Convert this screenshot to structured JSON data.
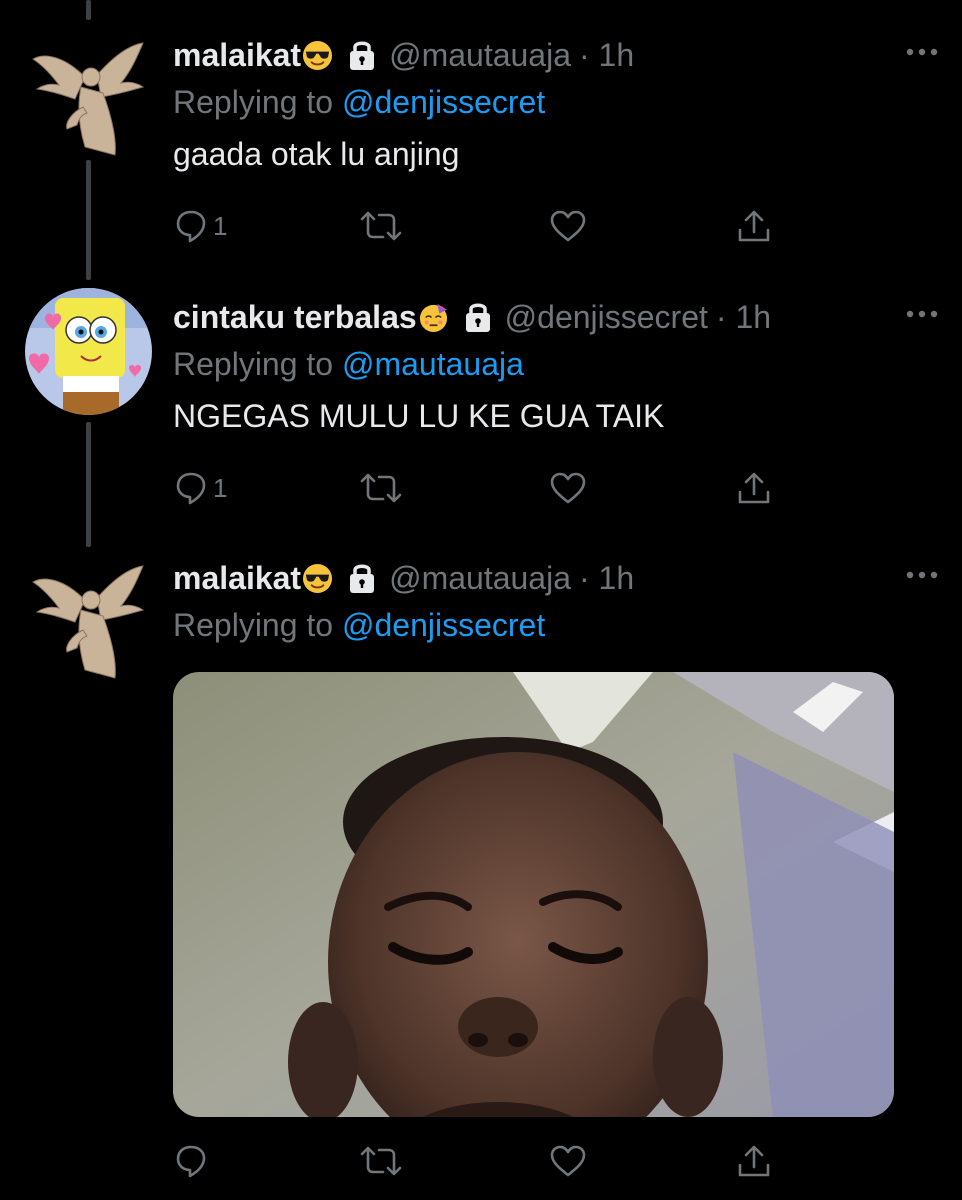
{
  "tweets": [
    {
      "display_name": "malaikat",
      "name_emoji": "sunglasses-face",
      "protected": true,
      "handle": "@mautauaja",
      "time": "· 1h",
      "replying_prefix": "Replying to",
      "replying_to": "@denjissecret",
      "text": "gaada otak lu anjing",
      "reply_count": "1",
      "avatar": "winged-angel-statue"
    },
    {
      "display_name": "cintaku terbalas",
      "name_emoji": "partying-face",
      "protected": true,
      "handle": "@denjissecret",
      "time": "· 1h",
      "replying_prefix": "Replying to",
      "replying_to": "@mautauaja",
      "text": "NGEGAS MULU LU KE GUA TAIK",
      "reply_count": "1",
      "avatar": "spongebob-with-hearts"
    },
    {
      "display_name": "malaikat",
      "name_emoji": "sunglasses-face",
      "protected": true,
      "handle": "@mautauaja",
      "time": "· 1h",
      "replying_prefix": "Replying to",
      "replying_to": "@denjissecret",
      "media": "photo-of-child-face-closeup",
      "avatar": "winged-angel-statue"
    }
  ],
  "icons": {
    "reply": "reply-icon",
    "retweet": "retweet-icon",
    "like": "like-heart-icon",
    "share": "share-icon",
    "more": "more-options-icon",
    "lock": "lock-icon"
  },
  "colors": {
    "background": "#000000",
    "text": "#e7e9ea",
    "secondary": "#71767b",
    "mention": "#1d9bf0",
    "thread_line": "#3e4144"
  }
}
